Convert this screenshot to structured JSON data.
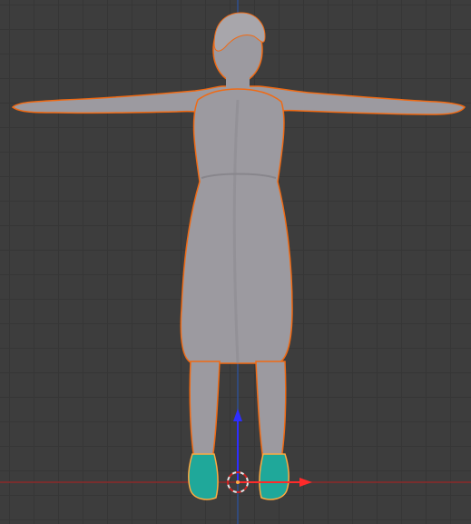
{
  "viewport": {
    "type": "3d-viewport",
    "view": "front-orthographic",
    "colors": {
      "background": "#3d3d3d",
      "grid": "#363636",
      "x_axis": "#8b2a2a",
      "z_axis": "#2e4f8f",
      "selection_outline": "#f06a14",
      "active_selection": "#ffaa40",
      "mesh": "#9c9aa0",
      "shoes_selected": "#1fa89a",
      "gizmo_x": "#ff2a2a",
      "gizmo_z": "#2e2eff",
      "cursor_ring": "#e6e6e6",
      "cursor_dash": "#cc2222"
    }
  },
  "objects": [
    {
      "name": "character-body",
      "state": "selected"
    },
    {
      "name": "shoes",
      "state": "active"
    }
  ],
  "gizmo": {
    "type": "translate",
    "axes": [
      "x",
      "z"
    ]
  },
  "cursor": {
    "type": "3d-cursor"
  }
}
